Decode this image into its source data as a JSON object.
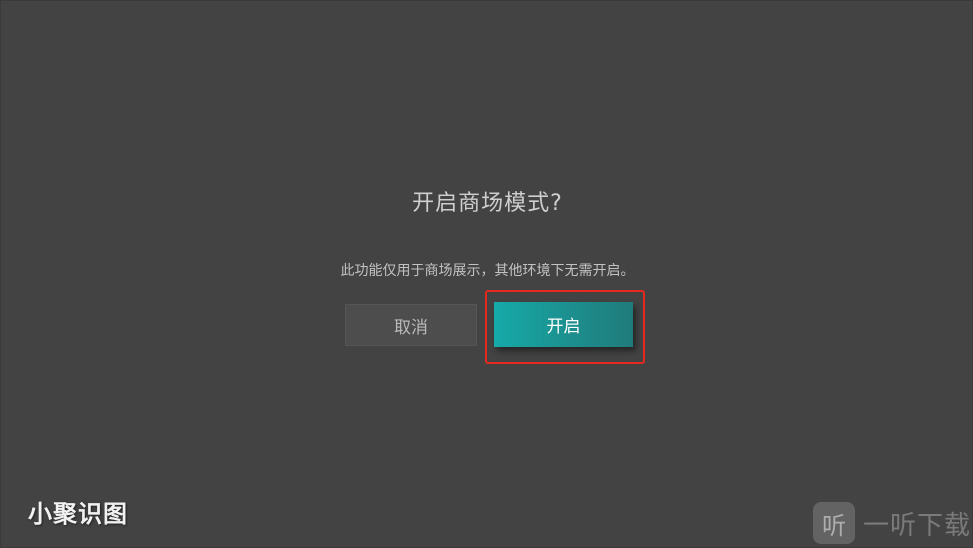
{
  "dialog": {
    "title": "开启商场模式?",
    "message": "此功能仅用于商场展示，其他环境下无需开启。",
    "cancel_label": "取消",
    "enable_label": "开启"
  },
  "watermarks": {
    "left_text": "小聚识图",
    "right_logo_char": "听",
    "right_text": "一听下载"
  },
  "colors": {
    "background": "#434343",
    "accent": "#16aaa8",
    "highlight": "#e5291f"
  }
}
